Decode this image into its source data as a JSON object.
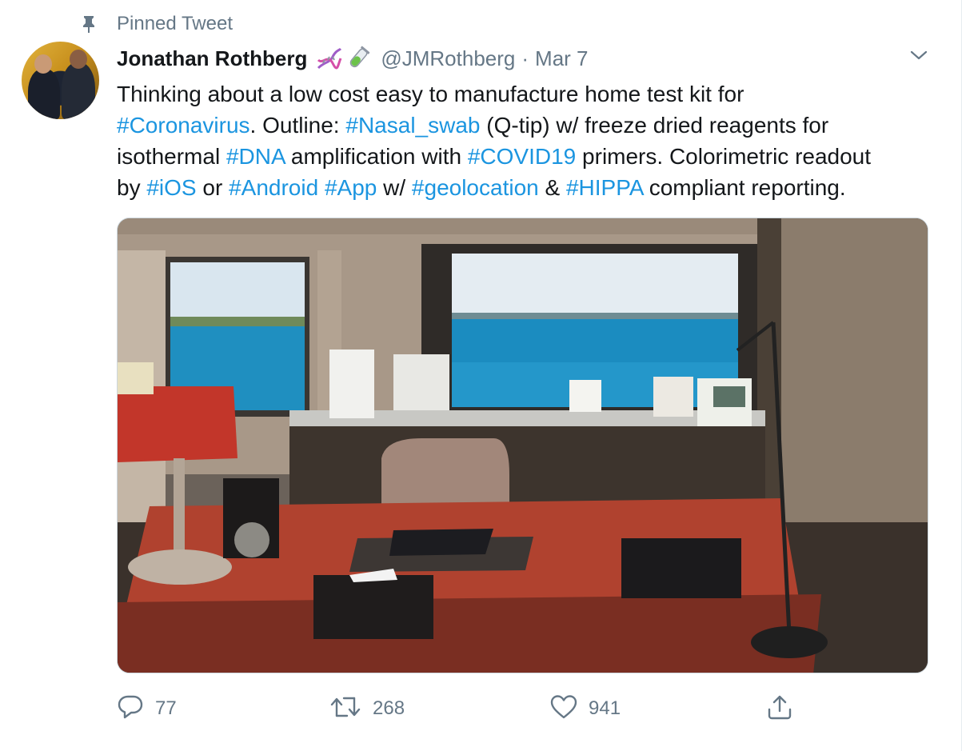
{
  "pinned": {
    "label": "Pinned Tweet",
    "icon": "pin-icon"
  },
  "author": {
    "name": "Jonathan Rothberg",
    "emoji": [
      "dna-emoji",
      "test-tube-emoji"
    ],
    "handle": "@JMRothberg",
    "separator": "·",
    "date": "Mar 7"
  },
  "tweet": {
    "segments": [
      [
        {
          "t": "Thinking about a low cost easy to manufacture home test kit for",
          "tag": false
        }
      ],
      [
        {
          "t": "#Coronavirus",
          "tag": true
        },
        {
          "t": ". Outline: ",
          "tag": false
        },
        {
          "t": "#Nasal_swab",
          "tag": true
        },
        {
          "t": " (Q-tip) w/ freeze dried reagents for",
          "tag": false
        }
      ],
      [
        {
          "t": "isothermal ",
          "tag": false
        },
        {
          "t": "#DNA",
          "tag": true
        },
        {
          "t": " amplification with ",
          "tag": false
        },
        {
          "t": "#COVID19",
          "tag": true
        },
        {
          "t": " primers. Colorimetric readout",
          "tag": false
        }
      ],
      [
        {
          "t": "by ",
          "tag": false
        },
        {
          "t": "#iOS",
          "tag": true
        },
        {
          "t": " or ",
          "tag": false
        },
        {
          "t": "#Android",
          "tag": true
        },
        {
          "t": " ",
          "tag": false
        },
        {
          "t": "#App",
          "tag": true
        },
        {
          "t": " w/ ",
          "tag": false
        },
        {
          "t": "#geolocation",
          "tag": true
        },
        {
          "t": " & ",
          "tag": false
        },
        {
          "t": "#HIPPA",
          "tag": true
        },
        {
          "t": " compliant reporting.",
          "tag": false
        }
      ]
    ]
  },
  "actions": {
    "reply": {
      "icon": "reply-icon",
      "count": "77"
    },
    "retweet": {
      "icon": "retweet-icon",
      "count": "268"
    },
    "like": {
      "icon": "heart-icon",
      "count": "941"
    },
    "share": {
      "icon": "share-icon"
    }
  },
  "colors": {
    "link": "#1b95e0",
    "muted": "#657786",
    "text": "#14171a"
  }
}
